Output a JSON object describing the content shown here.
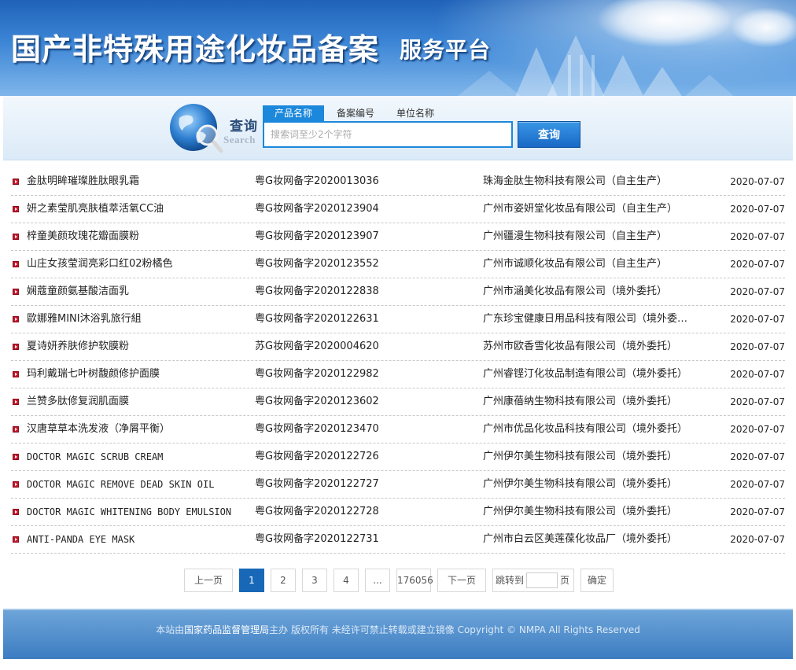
{
  "header": {
    "title": "国产非特殊用途化妆品备案",
    "subtitle": "服务平台"
  },
  "search": {
    "label_cn": "查询",
    "label_en": "Search",
    "tabs": [
      {
        "label": "产品名称",
        "active": true
      },
      {
        "label": "备案编号",
        "active": false
      },
      {
        "label": "单位名称",
        "active": false
      }
    ],
    "placeholder": "搜索词至少2个字符",
    "value": "",
    "button_label": "查询"
  },
  "results": [
    {
      "name": "金肽明眸璀璨胜肽眼乳霜",
      "code": "粤G妆网备字2020013036",
      "company": "珠海金肽生物科技有限公司（自主生产）",
      "date": "2020-07-07"
    },
    {
      "name": "妍之素莹肌亮肤植萃活氧CC油",
      "code": "粤G妆网备字2020123904",
      "company": "广州市姿妍堂化妆品有限公司（自主生产）",
      "date": "2020-07-07"
    },
    {
      "name": "梓童美颜玫瑰花瓣面膜粉",
      "code": "粤G妆网备字2020123907",
      "company": "广州疆漫生物科技有限公司（自主生产）",
      "date": "2020-07-07"
    },
    {
      "name": "山庄女孩莹润亮彩口红02粉橘色",
      "code": "粤G妆网备字2020123552",
      "company": "广州市诚顺化妆品有限公司（自主生产）",
      "date": "2020-07-07"
    },
    {
      "name": "娴蔻童颜氨基酸洁面乳",
      "code": "粤G妆网备字2020122838",
      "company": "广州市涵美化妆品有限公司（境外委托）",
      "date": "2020-07-07"
    },
    {
      "name": "歐娜雅MINI沐浴乳旅行組",
      "code": "粤G妆网备字2020122631",
      "company": "广东珍宝健康日用品科技有限公司（境外委托）",
      "date": "2020-07-07"
    },
    {
      "name": "夏诗妍养肤修护软膜粉",
      "code": "苏G妆网备字2020004620",
      "company": "苏州市欧香雪化妆品有限公司（境外委托）",
      "date": "2020-07-07"
    },
    {
      "name": "玛利戴瑞七叶树馥颜修护面膜",
      "code": "粤G妆网备字2020122982",
      "company": "广州睿铿汀化妆品制造有限公司（境外委托）",
      "date": "2020-07-07"
    },
    {
      "name": "兰赞多肽修复润肌面膜",
      "code": "粤G妆网备字2020123602",
      "company": "广州康蓓纳生物科技有限公司（境外委托）",
      "date": "2020-07-07"
    },
    {
      "name": "汉唐草草本洗发液（净屑平衡）",
      "code": "粤G妆网备字2020123470",
      "company": "广州市优品化妆品科技有限公司（境外委托）",
      "date": "2020-07-07"
    },
    {
      "name": "DOCTOR MAGIC SCRUB CREAM",
      "code": "粤G妆网备字2020122726",
      "company": "广州伊尔美生物科技有限公司（境外委托）",
      "date": "2020-07-07"
    },
    {
      "name": "DOCTOR MAGIC REMOVE DEAD SKIN OIL",
      "code": "粤G妆网备字2020122727",
      "company": "广州伊尔美生物科技有限公司（境外委托）",
      "date": "2020-07-07"
    },
    {
      "name": "DOCTOR MAGIC WHITENING BODY EMULSION",
      "code": "粤G妆网备字2020122728",
      "company": "广州伊尔美生物科技有限公司（境外委托）",
      "date": "2020-07-07"
    },
    {
      "name": "ANTI-PANDA EYE MASK",
      "code": "粤G妆网备字2020122731",
      "company": "广州市白云区美莲葆化妆品厂（境外委托）",
      "date": "2020-07-07"
    }
  ],
  "pagination": {
    "prev": "上一页",
    "pages": [
      "1",
      "2",
      "3",
      "4"
    ],
    "current": "1",
    "ellipsis": "...",
    "total": "176056",
    "next": "下一页",
    "jump_label": "跳转到",
    "jump_value": "",
    "page_suffix": "页",
    "confirm": "确定"
  },
  "footer": {
    "prefix": "本站由",
    "org": "国家药品监督管理局",
    "suffix": "主办 版权所有 未经许可禁止转载或建立镜像 Copyright © NMPA All Rights Reserved"
  },
  "colors": {
    "accent": "#1b88db",
    "pager_active": "#1868b7",
    "bullet": "#c8162b"
  }
}
